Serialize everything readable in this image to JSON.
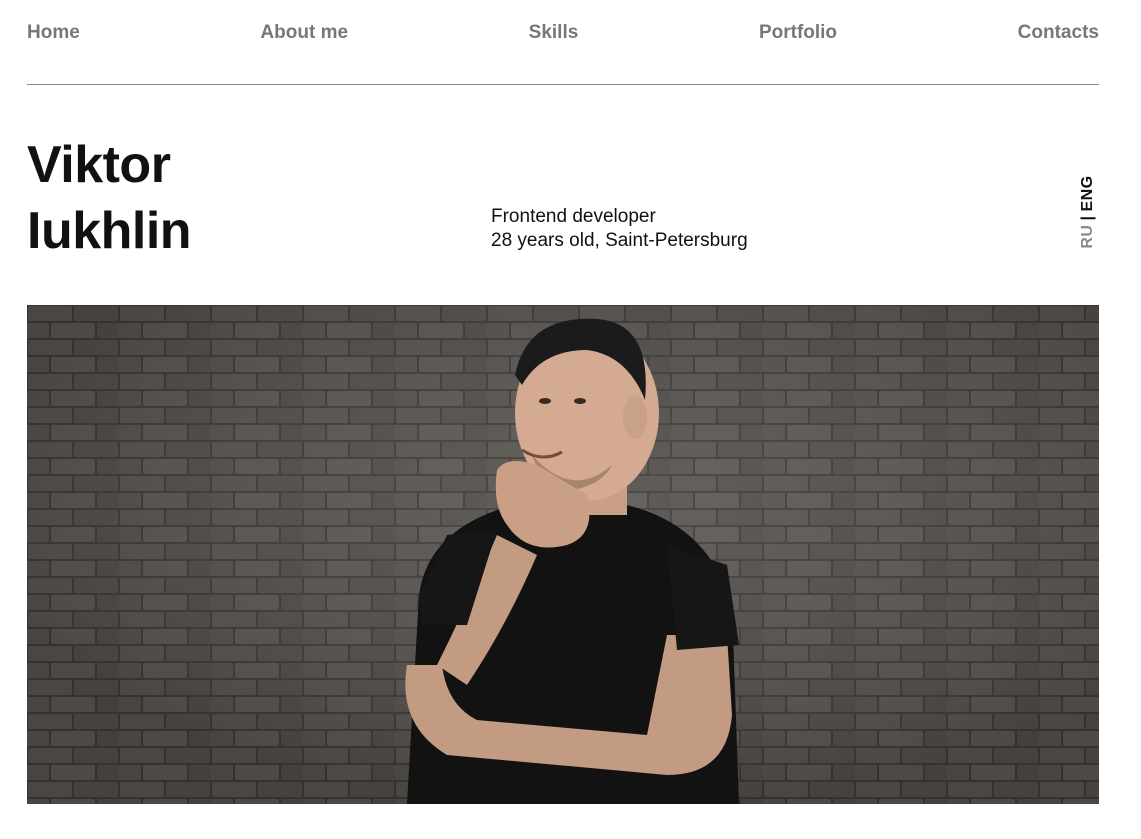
{
  "nav": {
    "items": [
      {
        "label": "Home"
      },
      {
        "label": "About me"
      },
      {
        "label": "Skills"
      },
      {
        "label": "Portfolio"
      },
      {
        "label": "Contacts"
      }
    ]
  },
  "hero": {
    "first_name": "Viktor",
    "last_name": "Iukhlin",
    "role": "Frontend developer",
    "details": "28 years old, Saint-Petersburg"
  },
  "language": {
    "ru": "RU",
    "separator": "|",
    "eng": "ENG",
    "active": "ENG"
  },
  "photo": {
    "subject": "portrait-photo"
  },
  "colors": {
    "nav_text": "#777777",
    "heading": "#111111",
    "divider": "#8a8a8a",
    "wall": "#4a4642"
  }
}
